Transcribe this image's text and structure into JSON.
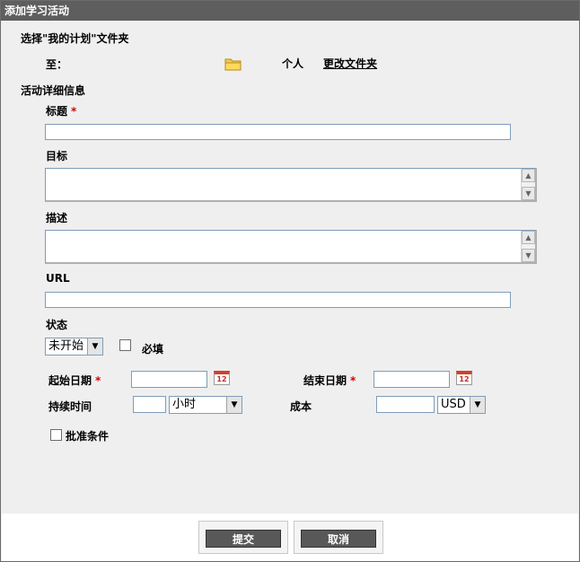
{
  "dialog": {
    "title": "添加学习活动"
  },
  "folder_section": {
    "heading": "选择\"我的计划\"文件夹",
    "to_label": "至：",
    "folder_icon": "folder-icon",
    "folder_name": "个人",
    "change_link": "更改文件夹"
  },
  "details_section": {
    "heading": "活动详细信息",
    "title_label": "标题",
    "required_mark": "*",
    "title_value": "",
    "goal_label": "目标",
    "goal_value": "",
    "description_label": "描述",
    "description_value": "",
    "url_label": "URL",
    "url_value": "",
    "status_label": "状态",
    "status_selected": "未开始",
    "required_checkbox_label": "必填",
    "start_date_label": "起始日期",
    "start_date_value": "",
    "end_date_label": "结束日期",
    "end_date_value": "",
    "calendar_icon_text": "12",
    "duration_label": "持续时间",
    "duration_value": "",
    "duration_unit_selected": "小时",
    "cost_label": "成本",
    "cost_value": "",
    "currency_selected": "USD",
    "approval_label": "批准条件"
  },
  "footer": {
    "submit_label": "提交",
    "cancel_label": "取消"
  }
}
